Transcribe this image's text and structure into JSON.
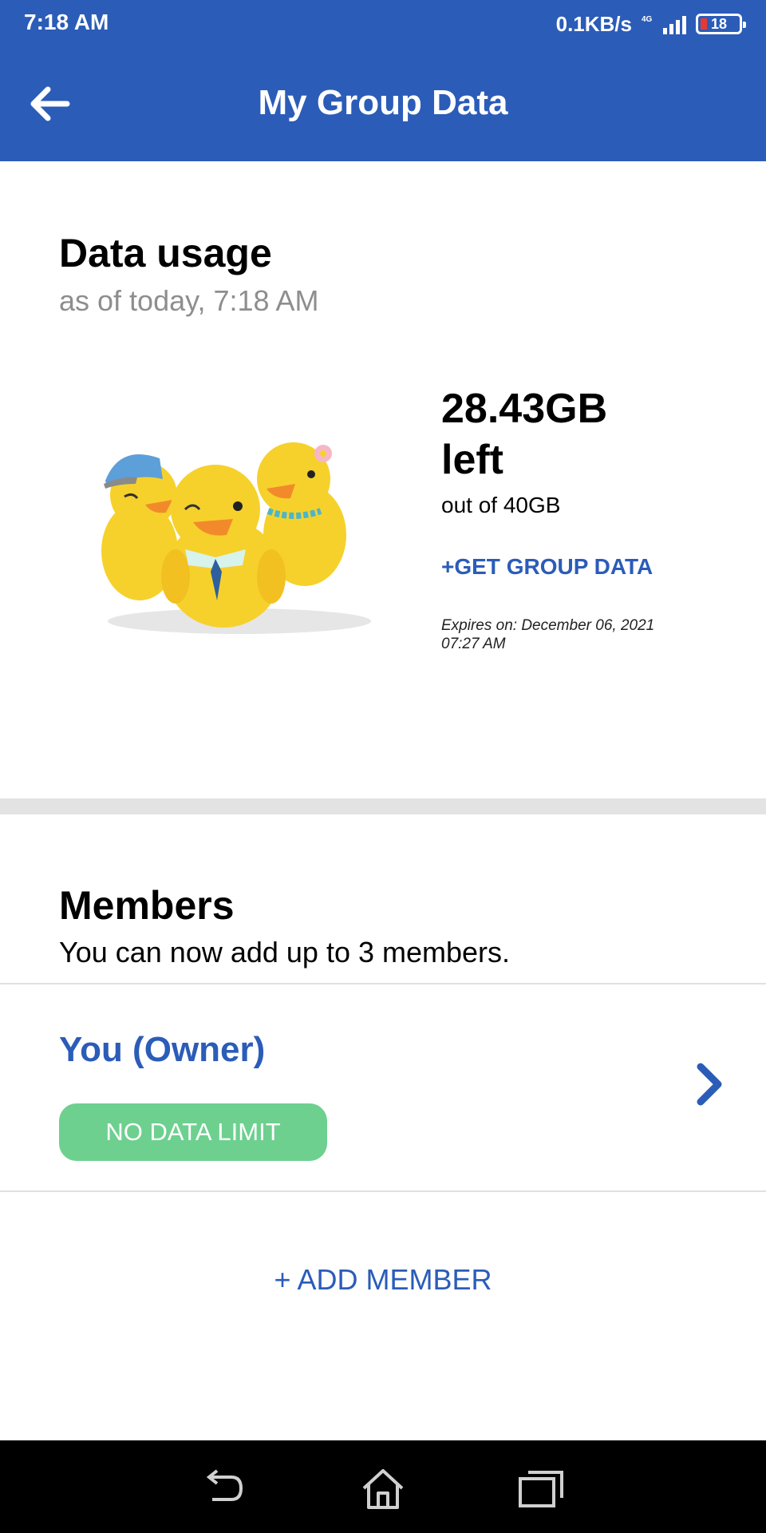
{
  "status_bar": {
    "time": "7:18 AM",
    "speed": "0.1KB/s",
    "network": "4G",
    "battery_level": "18",
    "signal_bars": 4
  },
  "app_bar": {
    "title": "My Group Data",
    "back_icon": "back-arrow-icon"
  },
  "usage": {
    "title": "Data usage",
    "as_of": "as of today, 7:18 AM",
    "illustration": "three-ducks-illustration",
    "amount_left": "28.43GB",
    "left_label": "left",
    "total": "out of 40GB",
    "get_data_label": "+GET GROUP DATA",
    "expires_line1": "Expires on: December 06, 2021",
    "expires_line2": "07:27 AM"
  },
  "members": {
    "title": "Members",
    "subtitle": "You can now add up to 3 members.",
    "list": [
      {
        "name": "You (Owner)",
        "limit": "NO DATA LIMIT"
      }
    ],
    "add_label": "+ ADD MEMBER"
  },
  "nav_bar": {
    "icons": [
      "back-icon",
      "home-icon",
      "recents-icon"
    ]
  },
  "colors": {
    "primary": "#2b5cb8",
    "badge": "#6dd08f",
    "divider": "#e3e3e3",
    "muted_text": "#8e8e8e"
  }
}
